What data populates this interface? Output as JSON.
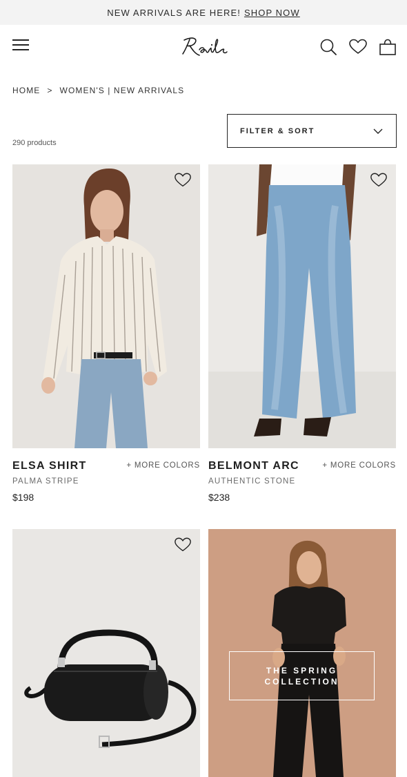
{
  "promo": {
    "text": "NEW ARRIVALS ARE HERE!",
    "link": "SHOP NOW"
  },
  "header": {
    "logo": "Rails",
    "icons": [
      "menu-icon",
      "search-icon",
      "heart-icon",
      "bag-icon"
    ]
  },
  "breadcrumb": {
    "home": "HOME",
    "separator": ">",
    "current": "WOMEN'S | NEW ARRIVALS"
  },
  "listing": {
    "product_count": "290 products",
    "filter_label": "FILTER & SORT"
  },
  "products": [
    {
      "name": "ELSA SHIRT",
      "more_colors": "+ MORE COLORS",
      "color": "PALMA STRIPE",
      "price": "$198"
    },
    {
      "name": "BELMONT ARC",
      "more_colors": "+ MORE COLORS",
      "color": "AUTHENTIC STONE",
      "price": "$238"
    }
  ],
  "promo_tile": {
    "label": "THE SPRING COLLECTION"
  },
  "colors": {
    "accent": "#1d1d1d",
    "promo_bg": "#f3f3f3",
    "tile_bg": "#c8987f"
  }
}
